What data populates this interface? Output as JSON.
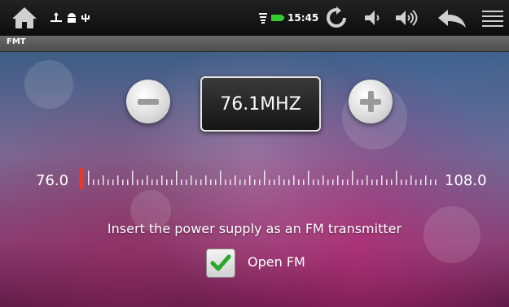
{
  "statusbar": {
    "time": "15:45",
    "icons": [
      "home-icon",
      "usb-icon",
      "android-debug-icon",
      "usb-storage-icon",
      "wifi-icon",
      "battery-icon",
      "refresh-icon",
      "volume-down-icon",
      "volume-up-icon",
      "back-icon",
      "menu-icon"
    ]
  },
  "titlebar": {
    "title": "FMT"
  },
  "tuner": {
    "frequency": "76.1MHZ",
    "min": "76.0",
    "max": "108.0",
    "needle_color": "#e33a2a"
  },
  "message": "Insert the power supply as an FM transmitter",
  "checkbox": {
    "label": "Open FM",
    "checked": true
  }
}
